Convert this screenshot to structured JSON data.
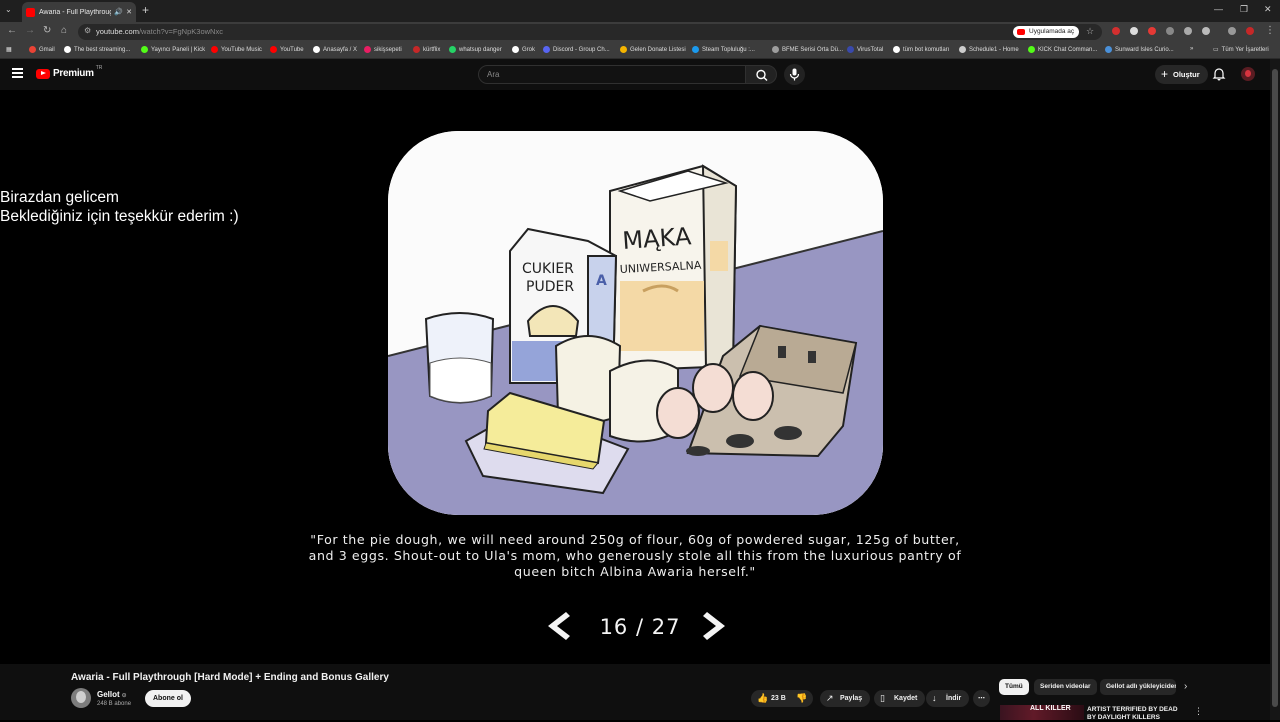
{
  "browser": {
    "tab": {
      "title": "Awaria - Full Playthrough [H"
    },
    "url": {
      "host": "youtube.com",
      "path": "/watch?v=FgNpK3owNxc"
    },
    "open_in_app": "Uygulamada aç",
    "bookmarks": [
      {
        "label": "Gmail",
        "color": "#ea4335"
      },
      {
        "label": "The best streaming...",
        "color": "#ffffff"
      },
      {
        "label": "Yayıncı Paneli | Kick",
        "color": "#53fc18"
      },
      {
        "label": "YouTube Music",
        "color": "#ff0000"
      },
      {
        "label": "YouTube",
        "color": "#ff0000"
      },
      {
        "label": "Anasayfa / X",
        "color": "#ffffff"
      },
      {
        "label": "sikişsepeti",
        "color": "#e91e63"
      },
      {
        "label": "kürtflix",
        "color": "#c62828"
      },
      {
        "label": "whatsup danger",
        "color": "#25d366"
      },
      {
        "label": "Grok",
        "color": "#ffffff"
      },
      {
        "label": "Discord - Group Ch...",
        "color": "#5865f2"
      },
      {
        "label": "Gelen Donate Listesi",
        "color": "#f4b400"
      },
      {
        "label": "Steam Topluluğu :...",
        "color": "#1b9aee"
      },
      {
        "label": "BFME Serisi Orta Dü...",
        "color": "#9e9e9e"
      },
      {
        "label": "VirusTotal",
        "color": "#3949ab"
      },
      {
        "label": "tüm bot komutları",
        "color": "#ffffff"
      },
      {
        "label": "Schedule1 - Home",
        "color": "#cccccc"
      },
      {
        "label": "KICK Chat Comman...",
        "color": "#53fc18"
      },
      {
        "label": "Sunward Isles Curio...",
        "color": "#4a90d9"
      }
    ],
    "all_bookmarks": "Tüm Yer İşaretleri"
  },
  "youtube": {
    "logo": "Premium",
    "country": "TR",
    "search_placeholder": "Ara",
    "create_label": "Oluştur"
  },
  "player": {
    "overlay_lines": [
      "Birazdan gelicem",
      "Beklediğiniz için teşekkür ederim :)"
    ],
    "bag_labels": {
      "flour_brand": "MĄKA",
      "flour_type": "UNIWERSALNA",
      "sugar_line1": "CUKIER",
      "sugar_line2": "PUDER",
      "letter": "A"
    },
    "caption": "\"For the pie dough, we will need around 250g of flour, 60g of powdered sugar, 125g of butter, and 3 eggs. Shout-out to Ula's mom, who generously stole all this from the luxurious pantry of queen bitch Albina Awaria herself.\"",
    "page_counter": "16 / 27",
    "current_page": 16,
    "total_pages": 27
  },
  "video": {
    "title": "Awaria - Full Playthrough [Hard Mode] + Ending and Bonus Gallery",
    "channel": "Gellot",
    "subscribers": "248 B abone",
    "subscribe_label": "Abone ol",
    "likes": "23 B",
    "share_label": "Paylaş",
    "save_label": "Kaydet",
    "download_label": "İndir"
  },
  "sidebar": {
    "chips": [
      "Tümü",
      "Seriden videolar",
      "Gellot adlı yükleyiciden"
    ],
    "rec_thumb_text": "ALL KILLER",
    "rec_title": "ARTIST TERRIFIED BY DEAD BY DAYLIGHT KILLERS"
  }
}
